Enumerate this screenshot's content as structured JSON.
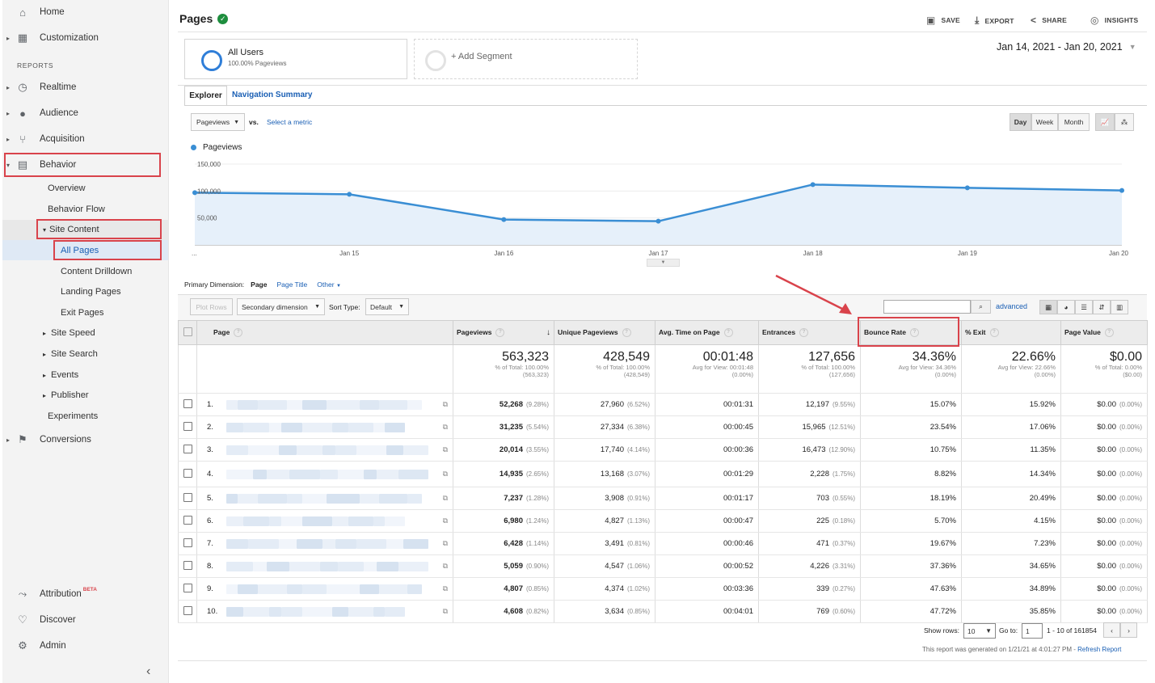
{
  "sidebar": {
    "home": "Home",
    "customization": "Customization",
    "reports_heading": "REPORTS",
    "realtime": "Realtime",
    "audience": "Audience",
    "acquisition": "Acquisition",
    "behavior": "Behavior",
    "overview": "Overview",
    "behavior_flow": "Behavior Flow",
    "site_content": "Site Content",
    "all_pages": "All Pages",
    "content_drilldown": "Content Drilldown",
    "landing_pages": "Landing Pages",
    "exit_pages": "Exit Pages",
    "site_speed": "Site Speed",
    "site_search": "Site Search",
    "events": "Events",
    "publisher": "Publisher",
    "experiments": "Experiments",
    "conversions": "Conversions",
    "attribution": "Attribution",
    "attribution_badge": "BETA",
    "discover": "Discover",
    "admin": "Admin",
    "collapse": "‹"
  },
  "header": {
    "title": "Pages",
    "save": "SAVE",
    "export": "EXPORT",
    "share": "SHARE",
    "insights": "INSIGHTS",
    "date_range": "Jan 14, 2021 - Jan 20, 2021"
  },
  "segments": {
    "all_users": "All Users",
    "all_users_sub": "100.00% Pageviews",
    "add_segment": "+ Add Segment"
  },
  "tabs": {
    "explorer": "Explorer",
    "nav_summary": "Navigation Summary"
  },
  "chart_controls": {
    "metric": "Pageviews",
    "vs": "vs.",
    "select_metric": "Select a metric",
    "day": "Day",
    "week": "Week",
    "month": "Month"
  },
  "chart_data": {
    "type": "line",
    "series": [
      {
        "name": "Pageviews",
        "values": [
          97000,
          94000,
          47000,
          44000,
          112000,
          106000,
          101000
        ]
      }
    ],
    "categories": [
      "...",
      "Jan 15",
      "Jan 16",
      "Jan 17",
      "Jan 18",
      "Jan 19",
      "Jan 20"
    ],
    "y_ticks": [
      "150,000",
      "100,000",
      "50,000"
    ],
    "ylim": [
      0,
      150000
    ],
    "line_color": "#3a8ed4",
    "fill_color": "#e6f0fa"
  },
  "dimension": {
    "label": "Primary Dimension:",
    "page": "Page",
    "page_title": "Page Title",
    "other": "Other"
  },
  "toolbar": {
    "plot_rows": "Plot Rows",
    "secondary_dimension": "Secondary dimension",
    "sort_type_label": "Sort Type:",
    "sort_default": "Default",
    "advanced": "advanced"
  },
  "table": {
    "headers": {
      "page": "Page",
      "pageviews": "Pageviews",
      "unique_pageviews": "Unique Pageviews",
      "avg_time": "Avg. Time on Page",
      "entrances": "Entrances",
      "bounce_rate": "Bounce Rate",
      "exit": "% Exit",
      "page_value": "Page Value"
    },
    "summary": {
      "pageviews": "563,323",
      "pageviews_sub1": "% of Total: 100.00%",
      "pageviews_sub2": "(563,323)",
      "unique": "428,549",
      "unique_sub1": "% of Total: 100.00%",
      "unique_sub2": "(428,549)",
      "avg_time": "00:01:48",
      "avg_time_sub1": "Avg for View: 00:01:48",
      "avg_time_sub2": "(0.00%)",
      "entrances": "127,656",
      "entrances_sub1": "% of Total: 100.00%",
      "entrances_sub2": "(127,656)",
      "bounce": "34.36%",
      "bounce_sub1": "Avg for View: 34.36%",
      "bounce_sub2": "(0.00%)",
      "exit": "22.66%",
      "exit_sub1": "Avg for View: 22.66%",
      "exit_sub2": "(0.00%)",
      "value": "$0.00",
      "value_sub1": "% of Total: 0.00%",
      "value_sub2": "($0.00)"
    },
    "rows": [
      {
        "n": "1.",
        "pv": "52,268",
        "pvp": "(9.28%)",
        "up": "27,960",
        "upp": "(6.52%)",
        "t": "00:01:31",
        "en": "12,197",
        "enp": "(9.55%)",
        "br": "15.07%",
        "ex": "15.92%",
        "val": "$0.00",
        "valp": "(0.00%)"
      },
      {
        "n": "2.",
        "pv": "31,235",
        "pvp": "(5.54%)",
        "up": "27,334",
        "upp": "(6.38%)",
        "t": "00:00:45",
        "en": "15,965",
        "enp": "(12.51%)",
        "br": "23.54%",
        "ex": "17.06%",
        "val": "$0.00",
        "valp": "(0.00%)"
      },
      {
        "n": "3.",
        "pv": "20,014",
        "pvp": "(3.55%)",
        "up": "17,740",
        "upp": "(4.14%)",
        "t": "00:00:36",
        "en": "16,473",
        "enp": "(12.90%)",
        "br": "10.75%",
        "ex": "11.35%",
        "val": "$0.00",
        "valp": "(0.00%)"
      },
      {
        "n": "4.",
        "pv": "14,935",
        "pvp": "(2.65%)",
        "up": "13,168",
        "upp": "(3.07%)",
        "t": "00:01:29",
        "en": "2,228",
        "enp": "(1.75%)",
        "br": "8.82%",
        "ex": "14.34%",
        "val": "$0.00",
        "valp": "(0.00%)"
      },
      {
        "n": "5.",
        "pv": "7,237",
        "pvp": "(1.28%)",
        "up": "3,908",
        "upp": "(0.91%)",
        "t": "00:01:17",
        "en": "703",
        "enp": "(0.55%)",
        "br": "18.19%",
        "ex": "20.49%",
        "val": "$0.00",
        "valp": "(0.00%)"
      },
      {
        "n": "6.",
        "pv": "6,980",
        "pvp": "(1.24%)",
        "up": "4,827",
        "upp": "(1.13%)",
        "t": "00:00:47",
        "en": "225",
        "enp": "(0.18%)",
        "br": "5.70%",
        "ex": "4.15%",
        "val": "$0.00",
        "valp": "(0.00%)"
      },
      {
        "n": "7.",
        "pv": "6,428",
        "pvp": "(1.14%)",
        "up": "3,491",
        "upp": "(0.81%)",
        "t": "00:00:46",
        "en": "471",
        "enp": "(0.37%)",
        "br": "19.67%",
        "ex": "7.23%",
        "val": "$0.00",
        "valp": "(0.00%)"
      },
      {
        "n": "8.",
        "pv": "5,059",
        "pvp": "(0.90%)",
        "up": "4,547",
        "upp": "(1.06%)",
        "t": "00:00:52",
        "en": "4,226",
        "enp": "(3.31%)",
        "br": "37.36%",
        "ex": "34.65%",
        "val": "$0.00",
        "valp": "(0.00%)"
      },
      {
        "n": "9.",
        "pv": "4,807",
        "pvp": "(0.85%)",
        "up": "4,374",
        "upp": "(1.02%)",
        "t": "00:03:36",
        "en": "339",
        "enp": "(0.27%)",
        "br": "47.63%",
        "ex": "34.89%",
        "val": "$0.00",
        "valp": "(0.00%)"
      },
      {
        "n": "10.",
        "pv": "4,608",
        "pvp": "(0.82%)",
        "up": "3,634",
        "upp": "(0.85%)",
        "t": "00:04:01",
        "en": "769",
        "enp": "(0.60%)",
        "br": "47.72%",
        "ex": "35.85%",
        "val": "$0.00",
        "valp": "(0.00%)"
      }
    ]
  },
  "pagination": {
    "show_rows_label": "Show rows:",
    "show_rows_value": "10",
    "goto_label": "Go to:",
    "goto_value": "1",
    "range": "1 - 10 of 161854",
    "generated": "This report was generated on 1/21/21 at 4:01:27 PM - ",
    "refresh": "Refresh Report"
  },
  "colors": {
    "highlight": "#d9434b",
    "link": "#1a5fb4",
    "series": "#3a8ed4"
  }
}
